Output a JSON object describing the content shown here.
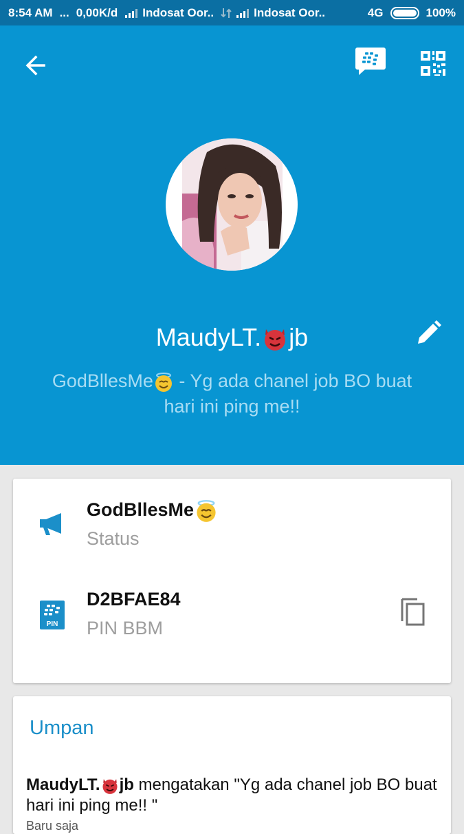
{
  "statusbar": {
    "time": "8:54 AM",
    "dots": "...",
    "speed": "0,00K/d",
    "carrier1": "Indosat Oor..",
    "carrier2": "Indosat Oor..",
    "network": "4G",
    "battery": "100%"
  },
  "header": {
    "back_icon": "arrow-left-icon",
    "bbm_icon": "bbm-chat-icon",
    "qr_icon": "qr-code-icon",
    "edit_icon": "pencil-icon"
  },
  "profile": {
    "name_prefix": "MaudyLT.",
    "name_emoji": "smiling-devil-emoji",
    "name_suffix": "jb",
    "status_prefix": "GodBllesMe",
    "status_emoji": "halo-smile-emoji",
    "status_suffix": " - Yg ada chanel job BO buat hari ini ping me!!"
  },
  "info": {
    "status_value": "GodBllesMe",
    "status_label": "Status",
    "pin_value": "D2BFAE84",
    "pin_label": "PIN BBM",
    "pin_icon_text": "PIN"
  },
  "feed": {
    "title": "Umpan",
    "author_prefix": "MaudyLT.",
    "author_suffix": "jb",
    "message": " mengatakan \"Yg ada chanel job BO buat hari ini ping me!! \"",
    "time": "Baru saja"
  },
  "colors": {
    "header_bg": "#0895d2",
    "statusbar_bg": "#0b6fa3",
    "accent": "#1b8fc9"
  }
}
